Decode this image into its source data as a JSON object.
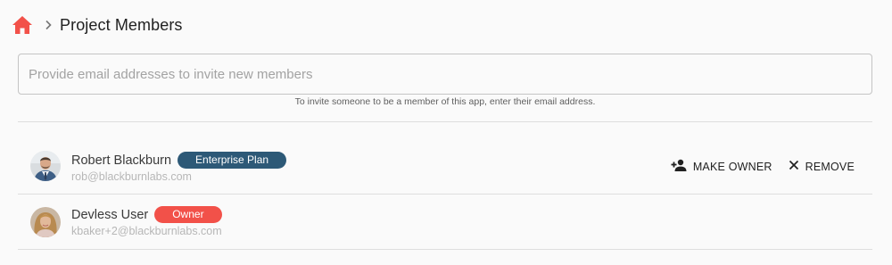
{
  "header": {
    "home_icon": "home-icon",
    "chevron_icon": "chevron-right-icon",
    "title": "Project Members"
  },
  "invite": {
    "value": "",
    "placeholder": "Provide email addresses to invite new members",
    "helper": "To invite someone to be a member of this app, enter their email address."
  },
  "members": [
    {
      "name": "Robert Blackburn",
      "email": "rob@blackburnlabs.com",
      "badge": "Enterprise Plan",
      "badge_color": "#2d5977",
      "avatar": "male-photo-avatar",
      "actions": {
        "make_owner_label": "MAKE OWNER",
        "make_owner_icon": "person-add-icon",
        "remove_label": "REMOVE",
        "remove_icon": "close-icon"
      }
    },
    {
      "name": "Devless User",
      "email": "kbaker+2@blackburnlabs.com",
      "badge": "Owner",
      "badge_color": "#f25149",
      "avatar": "female-photo-avatar"
    }
  ],
  "colors": {
    "accent": "#f25149",
    "enterprise_badge": "#2d5977",
    "background": "#fafafa",
    "divider": "#dedede"
  }
}
